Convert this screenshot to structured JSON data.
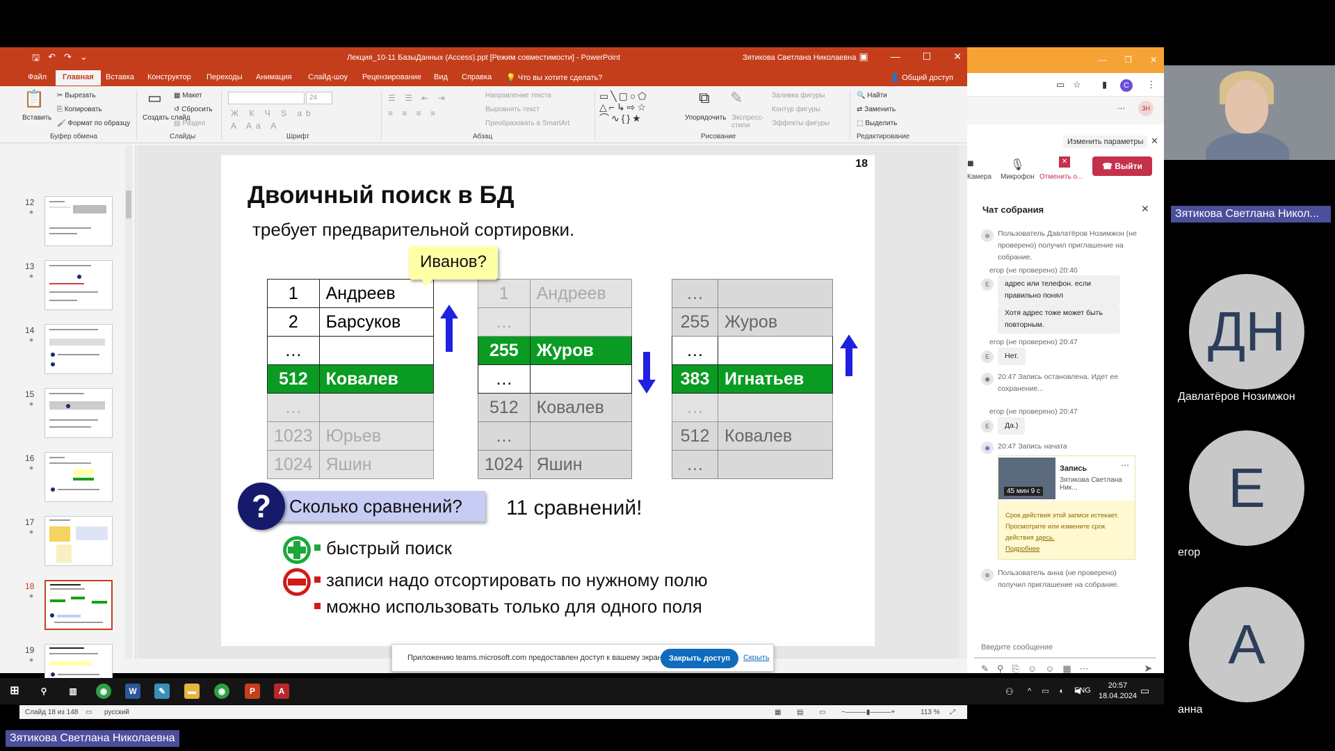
{
  "ppt": {
    "window_title": "Лекция_10-11 БазыДанных (Access).ppt [Режим совместимости]  -  PowerPoint",
    "user_name": "Зятикова Светлана Николаевна",
    "tabs": [
      "Файл",
      "Главная",
      "Вставка",
      "Конструктор",
      "Переходы",
      "Анимация",
      "Слайд-шоу",
      "Рецензирование",
      "Вид",
      "Справка"
    ],
    "tell_me": "Что вы хотите сделать?",
    "share_label": "Общий доступ",
    "ribbon": {
      "paste": "Вставить",
      "cut": "Вырезать",
      "copy": "Копировать",
      "format_painter": "Формат по образцу",
      "clipboard_group": "Буфер обмена",
      "new_slide": "Создать слайд",
      "layout": "Макет",
      "reset": "Сбросить",
      "section": "Раздел",
      "slides_group": "Слайды",
      "font_size": "24",
      "font_group": "Шрифт",
      "text_direction": "Направление текста",
      "align_text": "Выровнять текст",
      "smartart": "Преобразовать в SmartArt",
      "paragraph_group": "Абзац",
      "arrange": "Упорядочить",
      "quick_styles": "Экспресс-стили",
      "shape_fill": "Заливка фигуры",
      "shape_outline": "Контур фигуры",
      "shape_effects": "Эффекты фигуры",
      "drawing_group": "Рисование",
      "find": "Найти",
      "replace": "Заменить",
      "select": "Выделить",
      "editing_group": "Редактирование"
    },
    "thumbnails": [
      {
        "num": "12"
      },
      {
        "num": "13"
      },
      {
        "num": "14"
      },
      {
        "num": "15"
      },
      {
        "num": "16"
      },
      {
        "num": "17"
      },
      {
        "num": "18"
      },
      {
        "num": "19"
      }
    ],
    "status": {
      "slide_info": "Слайд 18 из 148",
      "language": "русский",
      "zoom": "113 %"
    },
    "share_banner": {
      "text": "Приложению teams.microsoft.com предоставлен доступ к вашему экрану.",
      "stop": "Закрыть доступ",
      "hide": "Скрыть"
    }
  },
  "slide": {
    "number": "18",
    "title": "Двоичный поиск в БД",
    "subtitle": "требует предварительной сортировки.",
    "callout": "Иванов?",
    "table1": [
      {
        "n": "1",
        "name": "Андреев",
        "style": "normal"
      },
      {
        "n": "2",
        "name": "Барсуков",
        "style": "normal"
      },
      {
        "n": "…",
        "name": "",
        "style": "normal"
      },
      {
        "n": "512",
        "name": "Ковалев",
        "style": "hl"
      },
      {
        "n": "…",
        "name": "",
        "style": "gray"
      },
      {
        "n": "1023",
        "name": "Юрьев",
        "style": "gray"
      },
      {
        "n": "1024",
        "name": "Яшин",
        "style": "gray"
      }
    ],
    "table2": [
      {
        "n": "1",
        "name": "Андреев",
        "style": "gray"
      },
      {
        "n": "…",
        "name": "",
        "style": "gray"
      },
      {
        "n": "255",
        "name": "Журов",
        "style": "hl"
      },
      {
        "n": "…",
        "name": "",
        "style": "normal"
      },
      {
        "n": "512",
        "name": "Ковалев",
        "style": "gray2"
      },
      {
        "n": "…",
        "name": "",
        "style": "gray2"
      },
      {
        "n": "1024",
        "name": "Яшин",
        "style": "gray2"
      }
    ],
    "table3": [
      {
        "n": "…",
        "name": "",
        "style": "gray2"
      },
      {
        "n": "255",
        "name": "Журов",
        "style": "gray2"
      },
      {
        "n": "…",
        "name": "",
        "style": "normal"
      },
      {
        "n": "383",
        "name": "Игнатьев",
        "style": "hl"
      },
      {
        "n": "…",
        "name": "",
        "style": "gray"
      },
      {
        "n": "512",
        "name": "Ковалев",
        "style": "gray2"
      },
      {
        "n": "…",
        "name": "",
        "style": "gray2"
      }
    ],
    "question": "Сколько сравнений?",
    "answer": "11 сравнений!",
    "pros": [
      "быстрый поиск"
    ],
    "cons": [
      "записи надо отсортировать по нужному полю",
      "можно использовать только для одного поля"
    ],
    "colors": {
      "highlight": "#0a9b23",
      "arrow": "#2020e0",
      "ppt_accent": "#c43e1c"
    }
  },
  "teams": {
    "change_params": "Изменить параметры",
    "camera": "Камера",
    "mic": "Микрофон",
    "stop_share": "Отменить о...",
    "leave": "Выйти",
    "chat_title": "Чат собрания",
    "messages": [
      {
        "kind": "system",
        "text": "Пользователь Давлатёров Нозимжон (не проверено) получил приглашение на собрание."
      },
      {
        "kind": "meta",
        "text": "егор (не проверено)  20:40"
      },
      {
        "kind": "bubble",
        "text": "адрес или телефон. если правильно понял"
      },
      {
        "kind": "bubble",
        "text": "Хотя адрес тоже может быть повторным."
      },
      {
        "kind": "meta",
        "text": "егор (не проверено)  20:47"
      },
      {
        "kind": "bubble",
        "text": "Нет."
      },
      {
        "kind": "system",
        "text": "20:47   Запись остановлена. Идет ее сохранение..."
      },
      {
        "kind": "meta",
        "text": "егор (не проверено)  20:47"
      },
      {
        "kind": "bubble",
        "text": "Да.)"
      },
      {
        "kind": "system",
        "text": "20:47   Запись начата"
      },
      {
        "kind": "system",
        "text": "Пользователь анна (не проверено) получил приглашение на собрание."
      }
    ],
    "recording": {
      "title": "Запись",
      "owner": "Зятикова Светлана Ник...",
      "duration": "45 мин 9 с",
      "expiry": "Срок действия этой записи истекает. Просмотрите или измените срок действия",
      "here": "здесь.",
      "more": "Подробнее"
    },
    "input_placeholder": "Введите сообщение"
  },
  "participants": {
    "presenter_tag": "Зятикова Светлана Никол...",
    "people": [
      {
        "initials": "ДН",
        "name": "Давлатёров Нозимжон"
      },
      {
        "initials": "Е",
        "name": "егор"
      },
      {
        "initials": "А",
        "name": "анна"
      }
    ],
    "bottom_tag": "Зятикова Светлана Николаевна"
  },
  "taskbar": {
    "lang": "ENG",
    "time": "20:57",
    "date": "18.04.2024"
  }
}
